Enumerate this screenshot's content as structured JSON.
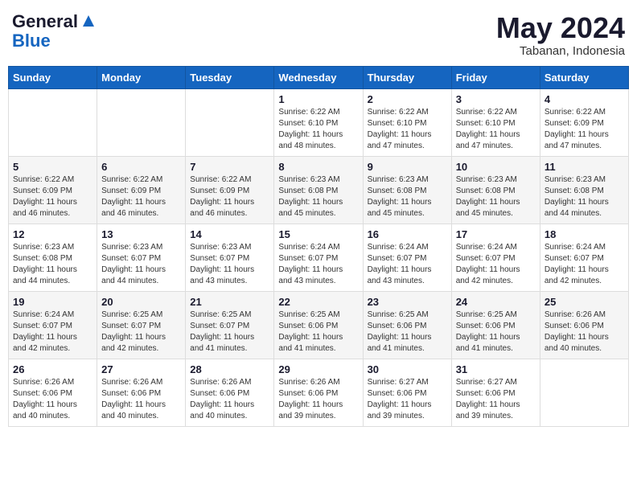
{
  "logo": {
    "line1": "General",
    "line2": "Blue"
  },
  "header": {
    "month": "May 2024",
    "location": "Tabanan, Indonesia"
  },
  "days_of_week": [
    "Sunday",
    "Monday",
    "Tuesday",
    "Wednesday",
    "Thursday",
    "Friday",
    "Saturday"
  ],
  "weeks": [
    [
      {
        "day": "",
        "sunrise": "",
        "sunset": "",
        "daylight": ""
      },
      {
        "day": "",
        "sunrise": "",
        "sunset": "",
        "daylight": ""
      },
      {
        "day": "",
        "sunrise": "",
        "sunset": "",
        "daylight": ""
      },
      {
        "day": "1",
        "sunrise": "Sunrise: 6:22 AM",
        "sunset": "Sunset: 6:10 PM",
        "daylight": "Daylight: 11 hours and 48 minutes."
      },
      {
        "day": "2",
        "sunrise": "Sunrise: 6:22 AM",
        "sunset": "Sunset: 6:10 PM",
        "daylight": "Daylight: 11 hours and 47 minutes."
      },
      {
        "day": "3",
        "sunrise": "Sunrise: 6:22 AM",
        "sunset": "Sunset: 6:10 PM",
        "daylight": "Daylight: 11 hours and 47 minutes."
      },
      {
        "day": "4",
        "sunrise": "Sunrise: 6:22 AM",
        "sunset": "Sunset: 6:09 PM",
        "daylight": "Daylight: 11 hours and 47 minutes."
      }
    ],
    [
      {
        "day": "5",
        "sunrise": "Sunrise: 6:22 AM",
        "sunset": "Sunset: 6:09 PM",
        "daylight": "Daylight: 11 hours and 46 minutes."
      },
      {
        "day": "6",
        "sunrise": "Sunrise: 6:22 AM",
        "sunset": "Sunset: 6:09 PM",
        "daylight": "Daylight: 11 hours and 46 minutes."
      },
      {
        "day": "7",
        "sunrise": "Sunrise: 6:22 AM",
        "sunset": "Sunset: 6:09 PM",
        "daylight": "Daylight: 11 hours and 46 minutes."
      },
      {
        "day": "8",
        "sunrise": "Sunrise: 6:23 AM",
        "sunset": "Sunset: 6:08 PM",
        "daylight": "Daylight: 11 hours and 45 minutes."
      },
      {
        "day": "9",
        "sunrise": "Sunrise: 6:23 AM",
        "sunset": "Sunset: 6:08 PM",
        "daylight": "Daylight: 11 hours and 45 minutes."
      },
      {
        "day": "10",
        "sunrise": "Sunrise: 6:23 AM",
        "sunset": "Sunset: 6:08 PM",
        "daylight": "Daylight: 11 hours and 45 minutes."
      },
      {
        "day": "11",
        "sunrise": "Sunrise: 6:23 AM",
        "sunset": "Sunset: 6:08 PM",
        "daylight": "Daylight: 11 hours and 44 minutes."
      }
    ],
    [
      {
        "day": "12",
        "sunrise": "Sunrise: 6:23 AM",
        "sunset": "Sunset: 6:08 PM",
        "daylight": "Daylight: 11 hours and 44 minutes."
      },
      {
        "day": "13",
        "sunrise": "Sunrise: 6:23 AM",
        "sunset": "Sunset: 6:07 PM",
        "daylight": "Daylight: 11 hours and 44 minutes."
      },
      {
        "day": "14",
        "sunrise": "Sunrise: 6:23 AM",
        "sunset": "Sunset: 6:07 PM",
        "daylight": "Daylight: 11 hours and 43 minutes."
      },
      {
        "day": "15",
        "sunrise": "Sunrise: 6:24 AM",
        "sunset": "Sunset: 6:07 PM",
        "daylight": "Daylight: 11 hours and 43 minutes."
      },
      {
        "day": "16",
        "sunrise": "Sunrise: 6:24 AM",
        "sunset": "Sunset: 6:07 PM",
        "daylight": "Daylight: 11 hours and 43 minutes."
      },
      {
        "day": "17",
        "sunrise": "Sunrise: 6:24 AM",
        "sunset": "Sunset: 6:07 PM",
        "daylight": "Daylight: 11 hours and 42 minutes."
      },
      {
        "day": "18",
        "sunrise": "Sunrise: 6:24 AM",
        "sunset": "Sunset: 6:07 PM",
        "daylight": "Daylight: 11 hours and 42 minutes."
      }
    ],
    [
      {
        "day": "19",
        "sunrise": "Sunrise: 6:24 AM",
        "sunset": "Sunset: 6:07 PM",
        "daylight": "Daylight: 11 hours and 42 minutes."
      },
      {
        "day": "20",
        "sunrise": "Sunrise: 6:25 AM",
        "sunset": "Sunset: 6:07 PM",
        "daylight": "Daylight: 11 hours and 42 minutes."
      },
      {
        "day": "21",
        "sunrise": "Sunrise: 6:25 AM",
        "sunset": "Sunset: 6:07 PM",
        "daylight": "Daylight: 11 hours and 41 minutes."
      },
      {
        "day": "22",
        "sunrise": "Sunrise: 6:25 AM",
        "sunset": "Sunset: 6:06 PM",
        "daylight": "Daylight: 11 hours and 41 minutes."
      },
      {
        "day": "23",
        "sunrise": "Sunrise: 6:25 AM",
        "sunset": "Sunset: 6:06 PM",
        "daylight": "Daylight: 11 hours and 41 minutes."
      },
      {
        "day": "24",
        "sunrise": "Sunrise: 6:25 AM",
        "sunset": "Sunset: 6:06 PM",
        "daylight": "Daylight: 11 hours and 41 minutes."
      },
      {
        "day": "25",
        "sunrise": "Sunrise: 6:26 AM",
        "sunset": "Sunset: 6:06 PM",
        "daylight": "Daylight: 11 hours and 40 minutes."
      }
    ],
    [
      {
        "day": "26",
        "sunrise": "Sunrise: 6:26 AM",
        "sunset": "Sunset: 6:06 PM",
        "daylight": "Daylight: 11 hours and 40 minutes."
      },
      {
        "day": "27",
        "sunrise": "Sunrise: 6:26 AM",
        "sunset": "Sunset: 6:06 PM",
        "daylight": "Daylight: 11 hours and 40 minutes."
      },
      {
        "day": "28",
        "sunrise": "Sunrise: 6:26 AM",
        "sunset": "Sunset: 6:06 PM",
        "daylight": "Daylight: 11 hours and 40 minutes."
      },
      {
        "day": "29",
        "sunrise": "Sunrise: 6:26 AM",
        "sunset": "Sunset: 6:06 PM",
        "daylight": "Daylight: 11 hours and 39 minutes."
      },
      {
        "day": "30",
        "sunrise": "Sunrise: 6:27 AM",
        "sunset": "Sunset: 6:06 PM",
        "daylight": "Daylight: 11 hours and 39 minutes."
      },
      {
        "day": "31",
        "sunrise": "Sunrise: 6:27 AM",
        "sunset": "Sunset: 6:06 PM",
        "daylight": "Daylight: 11 hours and 39 minutes."
      },
      {
        "day": "",
        "sunrise": "",
        "sunset": "",
        "daylight": ""
      }
    ]
  ]
}
